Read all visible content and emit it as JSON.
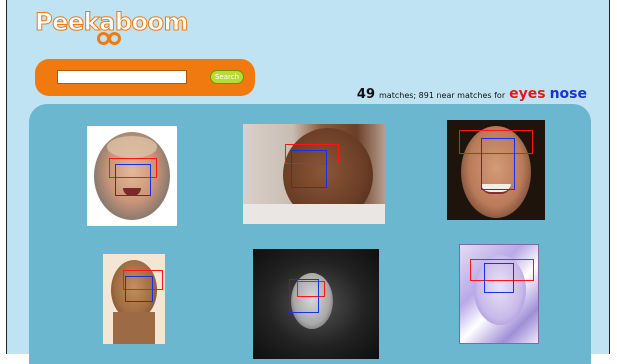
{
  "logo": {
    "part1": "Peek",
    "part2": "a",
    "part3": "boom"
  },
  "search": {
    "value": "",
    "placeholder": "",
    "button_label": "Search"
  },
  "summary": {
    "count": "49",
    "description": "matches; 891 near matches for",
    "term_eyes": "eyes",
    "term_nose": "nose"
  },
  "colors": {
    "brand_orange": "#f07a10",
    "page_bg": "#bfe3f3",
    "panel_bg": "#6bb7d0",
    "eyes_box": "#ff1414",
    "nose_box": "#1830e6",
    "search_button": "#b8dc33"
  },
  "results": [
    {
      "id": "result-1",
      "kind": "baby-face"
    },
    {
      "id": "result-2",
      "kind": "man-face"
    },
    {
      "id": "result-3",
      "kind": "woman-smile-face"
    },
    {
      "id": "result-4",
      "kind": "woman-face"
    },
    {
      "id": "result-5",
      "kind": "curly-hair-face"
    },
    {
      "id": "result-6",
      "kind": "painted-face"
    }
  ]
}
